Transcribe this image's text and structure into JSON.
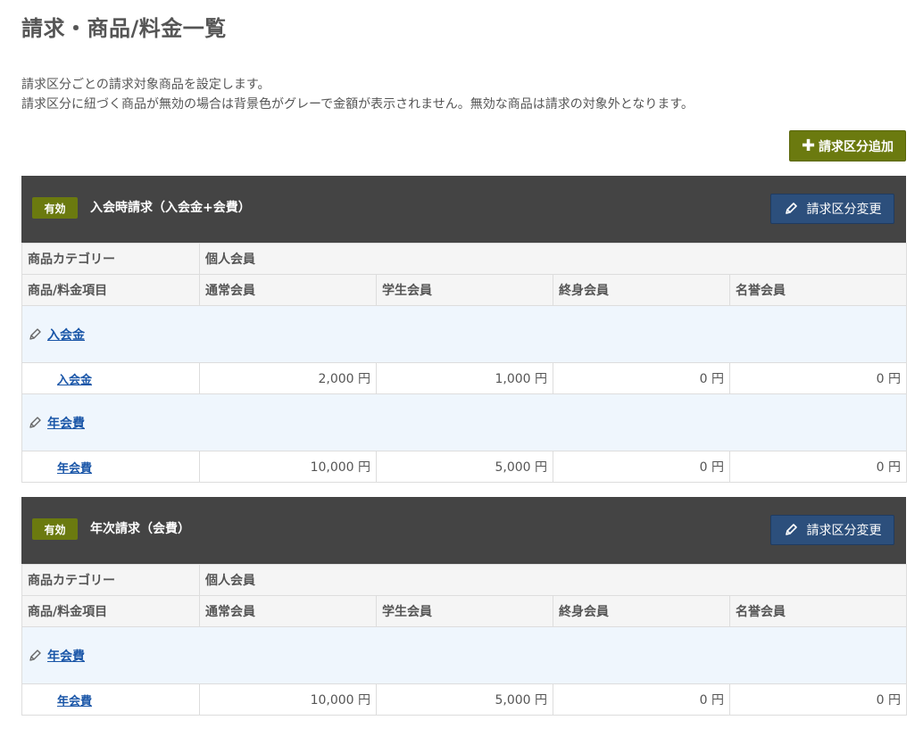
{
  "page": {
    "title": "請求・商品/料金一覧",
    "desc1": "請求区分ごとの請求対象商品を設定します。",
    "desc2": "請求区分に紐づく商品が無効の場合は背景色がグレーで金額が表示されません。無効な商品は請求の対象外となります。",
    "add_button": "請求区分追加",
    "add_icon": "plus-icon"
  },
  "sections": [
    {
      "badge": "有効",
      "title": "入会時請求（入会金+会費）",
      "edit_button": "請求区分変更",
      "category_label": "商品カテゴリー",
      "category_value": "個人会員",
      "item_label": "商品/料金項目",
      "columns": [
        "通常会員",
        "学生会員",
        "終身会員",
        "名誉会員"
      ],
      "groups": [
        {
          "name": "入会金",
          "items": [
            {
              "name": "入会金",
              "values": [
                "2,000 円",
                "1,000 円",
                "0 円",
                "0 円"
              ]
            }
          ]
        },
        {
          "name": "年会費",
          "items": [
            {
              "name": "年会費",
              "values": [
                "10,000 円",
                "5,000 円",
                "0 円",
                "0 円"
              ]
            }
          ]
        }
      ]
    },
    {
      "badge": "有効",
      "title": "年次請求（会費）",
      "edit_button": "請求区分変更",
      "category_label": "商品カテゴリー",
      "category_value": "個人会員",
      "item_label": "商品/料金項目",
      "columns": [
        "通常会員",
        "学生会員",
        "終身会員",
        "名誉会員"
      ],
      "groups": [
        {
          "name": "年会費",
          "items": [
            {
              "name": "年会費",
              "values": [
                "10,000 円",
                "5,000 円",
                "0 円",
                "0 円"
              ]
            }
          ]
        }
      ]
    }
  ],
  "colors": {
    "accent_green": "#6b7a0f",
    "header_dark": "#444444",
    "button_blue": "#2c4f7c",
    "link_blue": "#1a56a8",
    "category_bg": "#eff6fd"
  }
}
